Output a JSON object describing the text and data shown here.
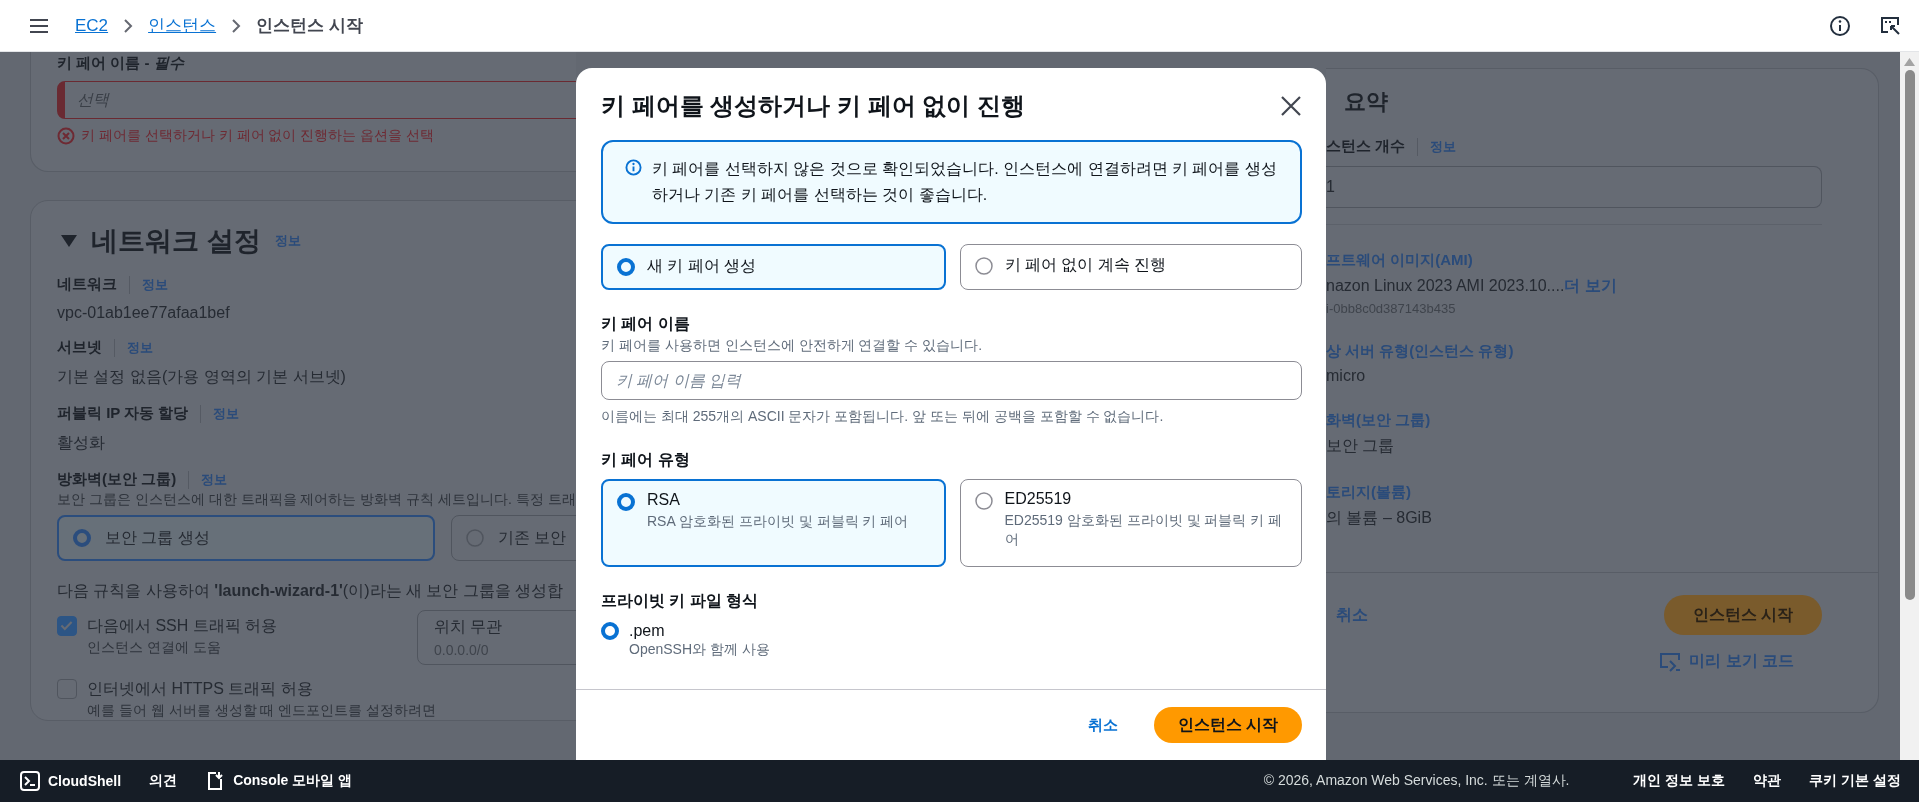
{
  "top_nav": {
    "breadcrumbs": [
      {
        "label": "EC2",
        "link": true
      },
      {
        "label": "인스턴스",
        "link": true
      },
      {
        "label": "인스턴스 시작",
        "link": false
      }
    ]
  },
  "key_pair_section": {
    "label": "키 페어 이름 - *필수*",
    "placeholder": "선택",
    "error": "키 페어를 선택하거나 키 페어 없이 진행하는 옵션을 선택"
  },
  "network_section": {
    "title": "네트워크 설정",
    "expanded": true,
    "info": "정보",
    "fields": [
      {
        "label": "네트워크",
        "info": "정보",
        "value": "vpc-01ab1ee77afaa1bef"
      },
      {
        "label": "서브넷",
        "info": "정보",
        "value": "기본 설정 없음(가용 영역의 기본 서브넷)"
      },
      {
        "label": "퍼블릭 IP 자동 할당",
        "info": "정보",
        "value": "활성화"
      }
    ],
    "firewall": {
      "label": "방화벽(보안 그룹)",
      "info": "정보",
      "description": "보안 그룹은 인스턴스에 대한 트래픽을 제어하는 방화벽 규칙 세트입니다. 특정 트래",
      "options": [
        {
          "label": "보안 그룹 생성",
          "selected": true
        },
        {
          "label": "기존 보안",
          "selected": false
        }
      ],
      "rule_text": "다음 규칙을 사용하여 **'launch-wizard-1'**(이)라는 새 보안 그룹을 생성합",
      "rules": [
        {
          "label": "다음에서 SSH 트래픽 허용",
          "description": "인스턴스 연결에 도움",
          "checked": true
        },
        {
          "label": "인터넷에서 HTTPS 트래픽 허용",
          "description": "예를 들어 웹 서버를 생성할 때 엔드포인트를 설정하려면",
          "checked": false
        }
      ],
      "source": {
        "value": "위치 무관",
        "sub": "0.0.0.0/0"
      }
    }
  },
  "dialog": {
    "title": "키 페어를 생성하거나 키 페어 없이 진행",
    "alert": "키 페어를 선택하지 않은 것으로 확인되었습니다. 인스턴스에 연결하려면 키 페어를 생성하거나 기존 키 페어를 선택하는 것이 좋습니다.",
    "mode_options": [
      {
        "label": "새 키 페어 생성",
        "selected": true
      },
      {
        "label": "키 페어 없이 계속 진행",
        "selected": false
      }
    ],
    "name_field": {
      "label": "키 페어 이름",
      "description": "키 페어를 사용하면 인스턴스에 안전하게 연결할 수 있습니다.",
      "placeholder": "키 페어 이름 입력",
      "hint": "이름에는 최대 255개의 ASCII 문자가 포함됩니다. 앞 또는 뒤에 공백을 포함할 수 없습니다."
    },
    "key_type": {
      "label": "키 페어 유형",
      "options": [
        {
          "label": "RSA",
          "description": "RSA 암호화된 프라이빗 및 퍼블릭 키 페어",
          "selected": true
        },
        {
          "label": "ED25519",
          "description": "ED25519 암호화된 프라이빗 및 퍼블릭 키 페어",
          "selected": false
        }
      ]
    },
    "file_format": {
      "label": "프라이빗 키 파일 형식",
      "options": [
        {
          "label": ".pem",
          "description": "OpenSSH와 함께 사용",
          "selected": true
        }
      ]
    },
    "cancel": "취소",
    "submit": "인스턴스 시작"
  },
  "summary": {
    "title": "요약",
    "count": {
      "label": "스턴스 개수",
      "info": "정보",
      "value": "1"
    },
    "items": [
      {
        "label": "프트웨어 이미지(AMI)",
        "value": "nazon Linux 2023 AMI 2023.10....",
        "more": "더 보기",
        "sub": "i-0bb8c0d387143b435"
      },
      {
        "label": "상 서버 유형(인스턴스 유형)",
        "value": "micro"
      },
      {
        "label": "화벽(보안 그룹)",
        "value": "보안 그룹"
      },
      {
        "label": "토리지(볼륨)",
        "value": "의 볼륨 – 8GiB"
      }
    ],
    "cancel": "취소",
    "submit": "인스턴스 시작",
    "preview": "미리 보기 코드"
  },
  "footer": {
    "cloudshell": "CloudShell",
    "feedback": "의견",
    "mobile": "Console 모바일 앱",
    "copyright": "© 2026, Amazon Web Services, Inc. 또는 계열사.",
    "links": [
      "개인 정보 보호",
      "약관",
      "쿠키 기본 설정"
    ]
  }
}
